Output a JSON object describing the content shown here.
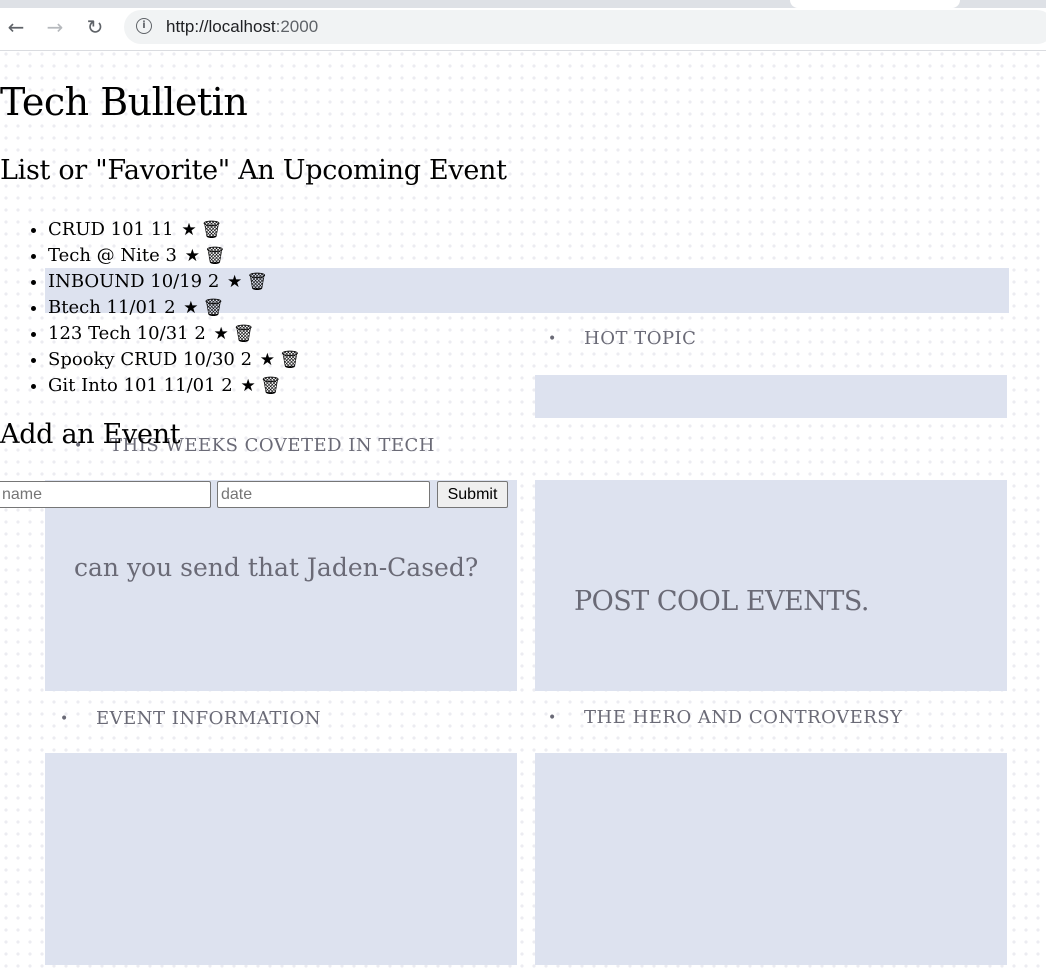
{
  "browser": {
    "url_host": "http://localhost",
    "url_port": ":2000",
    "back_icon": "←",
    "forward_icon": "→",
    "reload_icon": "↻",
    "info_icon": "i"
  },
  "page": {
    "title": "Tech Bulletin",
    "subtitle": "List or \"Favorite\" An Upcoming Event",
    "add_title": "Add an Event"
  },
  "events": [
    {
      "label": "CRUD 101 11"
    },
    {
      "label": "Tech @ Nite 3"
    },
    {
      "label": "INBOUND 10/19 2"
    },
    {
      "label": "Btech 11/01 2"
    },
    {
      "label": "123 Tech 10/31 2"
    },
    {
      "label": "Spooky CRUD 10/30 2"
    },
    {
      "label": "Git Into 101 11/01 2"
    }
  ],
  "icons": {
    "star": "★",
    "trash": "🗑"
  },
  "form": {
    "name_placeholder": "name",
    "date_placeholder": "date",
    "submit_label": "Submit"
  },
  "tiles": {
    "hot_topic": "HOT TOPIC",
    "weeks_coveted": "THIS WEEKS COVETED  IN  TECH",
    "jaden": "can you send that Jaden-Cased?",
    "post_cool": "POST COOL EVENTS.",
    "event_info": "EVENT INFORMATION",
    "hero": "THE HERO AND CONTROVERSY",
    "bullet": "•"
  },
  "colors": {
    "panel": "#dde2ef",
    "tile_text": "#6a6a76",
    "background_dot": "#ececf1"
  }
}
